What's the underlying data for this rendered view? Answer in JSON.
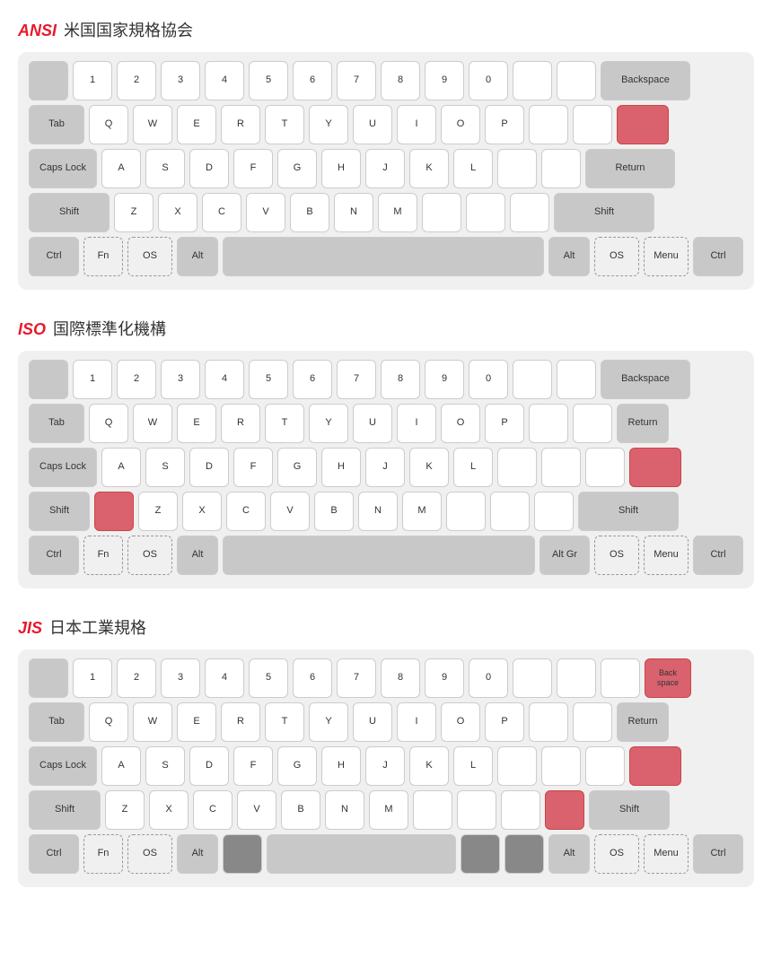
{
  "ansi": {
    "title_std": "ANSI",
    "title_desc": "米国国家規格協会",
    "row1": [
      "",
      "1",
      "2",
      "3",
      "4",
      "5",
      "6",
      "7",
      "8",
      "9",
      "0",
      "",
      "",
      "Backspace"
    ],
    "row2": [
      "Tab",
      "Q",
      "W",
      "E",
      "R",
      "T",
      "Y",
      "U",
      "I",
      "O",
      "P",
      "",
      "",
      ""
    ],
    "row3": [
      "Caps Lock",
      "A",
      "S",
      "D",
      "F",
      "G",
      "H",
      "J",
      "K",
      "L",
      "",
      "",
      "Return"
    ],
    "row4": [
      "Shift",
      "Z",
      "X",
      "C",
      "V",
      "B",
      "N",
      "M",
      "",
      "",
      "",
      "Shift"
    ],
    "row5": [
      "Ctrl",
      "Fn",
      "OS",
      "Alt",
      "",
      "Alt",
      "OS",
      "Menu",
      "Ctrl"
    ]
  },
  "iso": {
    "title_std": "ISO",
    "title_desc": "国際標準化機構",
    "row1": [
      "",
      "1",
      "2",
      "3",
      "4",
      "5",
      "6",
      "7",
      "8",
      "9",
      "0",
      "",
      "",
      "Backspace"
    ],
    "row2": [
      "Tab",
      "Q",
      "W",
      "E",
      "R",
      "T",
      "Y",
      "U",
      "I",
      "O",
      "P",
      "",
      ""
    ],
    "row3": [
      "Caps Lock",
      "A",
      "S",
      "D",
      "F",
      "G",
      "H",
      "J",
      "K",
      "L",
      "",
      "",
      ""
    ],
    "row4": [
      "Shift",
      "",
      "Z",
      "X",
      "C",
      "V",
      "B",
      "N",
      "M",
      "",
      "",
      "",
      "Shift"
    ],
    "row5": [
      "Ctrl",
      "Fn",
      "OS",
      "Alt",
      "",
      "Alt Gr",
      "OS",
      "Menu",
      "Ctrl"
    ]
  },
  "jis": {
    "title_std": "JIS",
    "title_desc": "日本工業規格",
    "row1": [
      "",
      "1",
      "2",
      "3",
      "4",
      "5",
      "6",
      "7",
      "8",
      "9",
      "0",
      "",
      "",
      "",
      "Back\nspace"
    ],
    "row2": [
      "Tab",
      "Q",
      "W",
      "E",
      "R",
      "T",
      "Y",
      "U",
      "I",
      "O",
      "P",
      "",
      "",
      ""
    ],
    "row3": [
      "Caps Lock",
      "A",
      "S",
      "D",
      "F",
      "G",
      "H",
      "J",
      "K",
      "L",
      "",
      "",
      ""
    ],
    "row4": [
      "Shift",
      "Z",
      "X",
      "C",
      "V",
      "B",
      "N",
      "M",
      "",
      "",
      "",
      "",
      "Shift"
    ],
    "row5": [
      "Ctrl",
      "Fn",
      "OS",
      "Alt",
      "",
      "",
      "",
      "",
      "Alt",
      "OS",
      "Menu",
      "Ctrl"
    ]
  }
}
